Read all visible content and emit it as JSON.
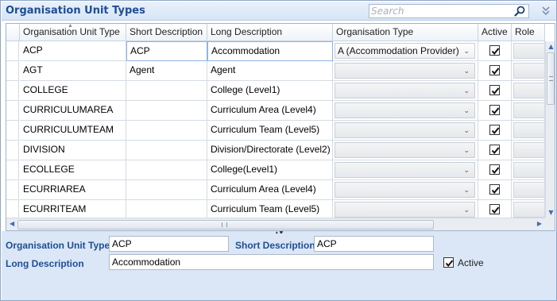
{
  "window": {
    "title": "Organisation Unit Types"
  },
  "search": {
    "placeholder": "Search"
  },
  "grid": {
    "columns": [
      "Organisation Unit Type",
      "Short Description",
      "Long Description",
      "Organisation Type",
      "Active",
      "Role"
    ],
    "rows": [
      {
        "code": "ACP",
        "short": "ACP",
        "long": "Accommodation",
        "org_type": "A (Accommodation Provider)",
        "active": true
      },
      {
        "code": "AGT",
        "short": "Agent",
        "long": "Agent",
        "org_type": "",
        "active": true
      },
      {
        "code": "COLLEGE",
        "short": "",
        "long": "College (Level1)",
        "org_type": "",
        "active": true
      },
      {
        "code": "CURRICULUMAREA",
        "short": "",
        "long": "Curriculum Area (Level4)",
        "org_type": "",
        "active": true
      },
      {
        "code": "CURRICULUMTEAM",
        "short": "",
        "long": "Curriculum Team (Level5)",
        "org_type": "",
        "active": true
      },
      {
        "code": "DIVISION",
        "short": "",
        "long": "Division/Directorate (Level2)",
        "org_type": "",
        "active": true
      },
      {
        "code": "ECOLLEGE",
        "short": "",
        "long": "College(Level1)",
        "org_type": "",
        "active": true
      },
      {
        "code": "ECURRIAREA",
        "short": "",
        "long": "Curriculum Area (Level4)",
        "org_type": "",
        "active": true
      },
      {
        "code": "ECURRITEAM",
        "short": "",
        "long": "Curriculum Team (Level5)",
        "org_type": "",
        "active": true
      }
    ]
  },
  "detail": {
    "unit_type_label": "Organisation Unit Type",
    "unit_type_value": "ACP",
    "short_desc_label": "Short Description",
    "short_desc_value": "ACP",
    "long_desc_label": "Long Description",
    "long_desc_value": "Accommodation",
    "active_label": "Active",
    "active": true
  },
  "icons": {
    "search": "magnifier-icon",
    "collapse": "double-chevron-down-icon"
  },
  "colors": {
    "title": "#1f4e93",
    "panel": "#dbe7f6",
    "header_bg": "#d7e5f6"
  }
}
